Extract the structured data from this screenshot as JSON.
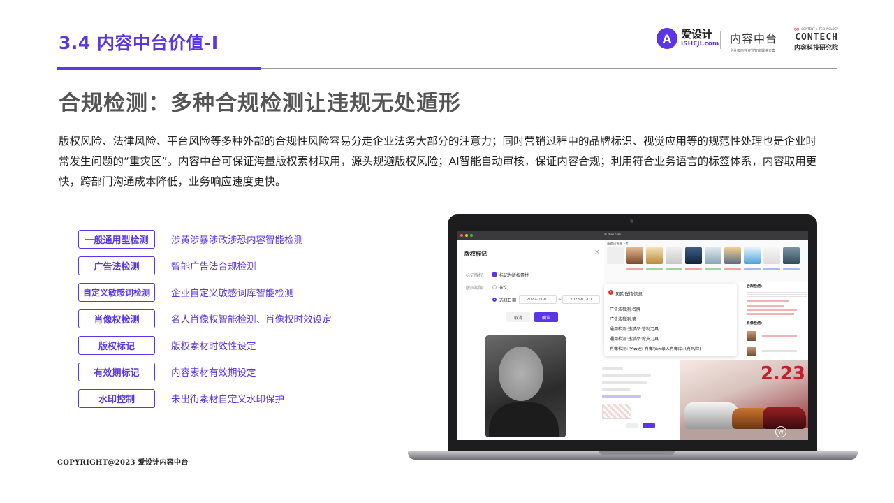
{
  "header": {
    "section_title": "3.4 内容中台价值-I",
    "logos": {
      "ishe_cn": "爱设计",
      "ishe_en": "iSHEJI.com",
      "platform_big": "内容中台",
      "platform_small": "企业级内容资管智能解决方案",
      "contech_tag": "CONTENT + TECHNOLOGY",
      "contech_name": "CONTECH",
      "contech_cn": "内容科技研究院"
    }
  },
  "headline": "合规检测：多种合规检测让违规无处遁形",
  "body_text": "版权风险、法律风险、平台风险等多种外部的合规性风险容易分走企业法务大部分的注意力；同时营销过程中的品牌标识、视觉应用等的规范性处理也是企业时常发生问题的“重灾区”。内容中台可保证海量版权素材取用，源头规避版权风险；AI智能自动审核，保证内容合规；利用符合业务语言的标签体系，内容取用更快，跨部门沟通成本降低，业务响应速度更快。",
  "features": [
    {
      "tag": "一般通用型检测",
      "desc": "涉黄涉暴涉政涉恐内容智能检测"
    },
    {
      "tag": "广告法检测",
      "desc": "智能广告法合规检测"
    },
    {
      "tag": "自定义敏感词检测",
      "desc": "企业自定义敏感词库智能检测"
    },
    {
      "tag": "肖像权检测",
      "desc": "名人肖像权智能检测、肖像权时效设定"
    },
    {
      "tag": "版权标记",
      "desc": "版权素材时效性设定"
    },
    {
      "tag": "有效期标记",
      "desc": "内容素材有效期设定"
    },
    {
      "tag": "水印控制",
      "desc": "未出街素材自定义水印保护"
    }
  ],
  "footer": {
    "copyright": "COPYRIGHT@2023 爱设计内容中台"
  },
  "screen": {
    "url": "ai.sheji.com",
    "copyright_panel": {
      "title": "版权标记",
      "close": "×",
      "field_label_1": "标记版权:",
      "checkbox_label": "标记为版权素材",
      "field_label_2": "版权期限:",
      "option_forever": "永久",
      "option_date": "选择日期",
      "date_start": "2022-01-01",
      "date_sep": "~",
      "date_end": "2023-01-01",
      "cancel": "取消",
      "confirm": "确认"
    },
    "gallery_title": "请输入/选择 上传",
    "risk": {
      "title": "风险详情信息",
      "lines": [
        "广告法检测:名牌",
        "广告法检测:第一",
        "通用检测:违禁品:管制刀具",
        "通用检测:违禁品:枪支刀具",
        "肖像检测: 李云迪: 肖像权未录入肖像库: (有风险)"
      ]
    },
    "risk_side": {
      "title1": "合规检测:",
      "title2": "肖像检测:"
    },
    "ad_number": "2.23"
  },
  "colors": {
    "accent": "#5b36e6",
    "danger": "#e03131"
  }
}
